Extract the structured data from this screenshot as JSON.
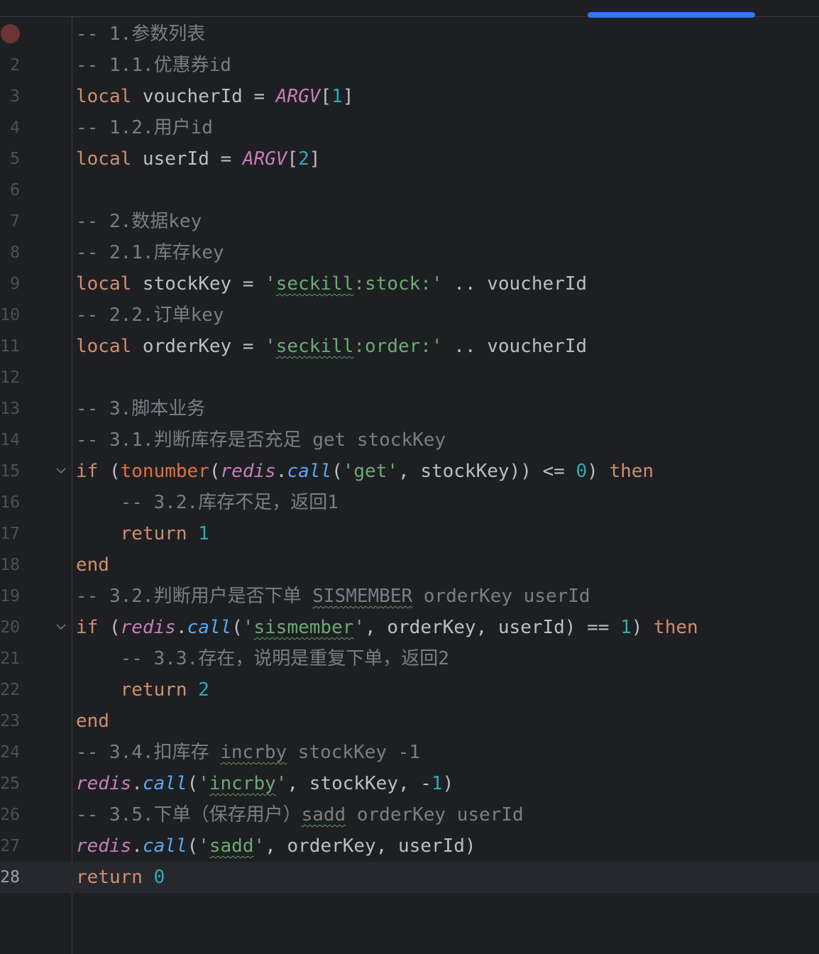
{
  "editor": {
    "current_line": 28,
    "breakpoint_line": 1,
    "fold_lines": [
      15,
      20
    ],
    "colors": {
      "background": "#1e1f22",
      "keyword": "#cf8e6d",
      "string": "#6aab73",
      "number": "#2aacb8",
      "comment": "#7a7e85",
      "global": "#c77dbb",
      "method": "#56a8f5",
      "scrollbar": "#3574f0"
    },
    "lines": [
      {
        "num": "1",
        "tokens": [
          [
            "c",
            "-- 1.参数列表"
          ]
        ]
      },
      {
        "num": "2",
        "tokens": [
          [
            "c",
            "-- 1.1.优惠券id"
          ]
        ]
      },
      {
        "num": "3",
        "tokens": [
          [
            "k",
            "local"
          ],
          [
            "t",
            " voucherId = "
          ],
          [
            "g",
            "ARGV"
          ],
          [
            "t",
            "["
          ],
          [
            "n",
            "1"
          ],
          [
            "t",
            "]"
          ]
        ]
      },
      {
        "num": "4",
        "tokens": [
          [
            "c",
            "-- 1.2.用户id"
          ]
        ]
      },
      {
        "num": "5",
        "tokens": [
          [
            "k",
            "local"
          ],
          [
            "t",
            " userId = "
          ],
          [
            "g",
            "ARGV"
          ],
          [
            "t",
            "["
          ],
          [
            "n",
            "2"
          ],
          [
            "t",
            "]"
          ]
        ]
      },
      {
        "num": "6",
        "tokens": []
      },
      {
        "num": "7",
        "tokens": [
          [
            "c",
            "-- 2.数据key"
          ]
        ]
      },
      {
        "num": "8",
        "tokens": [
          [
            "c",
            "-- 2.1.库存key"
          ]
        ]
      },
      {
        "num": "9",
        "tokens": [
          [
            "k",
            "local"
          ],
          [
            "t",
            " stockKey = "
          ],
          [
            "s",
            "'"
          ],
          [
            "s typo",
            "seckill"
          ],
          [
            "s",
            ":stock:'"
          ],
          [
            "t",
            " .. voucherId"
          ]
        ]
      },
      {
        "num": "10",
        "tokens": [
          [
            "c",
            "-- 2.2.订单key"
          ]
        ]
      },
      {
        "num": "11",
        "tokens": [
          [
            "k",
            "local"
          ],
          [
            "t",
            " orderKey = "
          ],
          [
            "s",
            "'"
          ],
          [
            "s typo",
            "seckill"
          ],
          [
            "s",
            ":order:'"
          ],
          [
            "t",
            " .. voucherId"
          ]
        ]
      },
      {
        "num": "12",
        "tokens": []
      },
      {
        "num": "13",
        "tokens": [
          [
            "c",
            "-- 3.脚本业务"
          ]
        ]
      },
      {
        "num": "14",
        "tokens": [
          [
            "c",
            "-- 3.1.判断库存是否充足 get stockKey"
          ]
        ]
      },
      {
        "num": "15",
        "tokens": [
          [
            "k",
            "if"
          ],
          [
            "t",
            " ("
          ],
          [
            "f",
            "tonumber"
          ],
          [
            "t",
            "("
          ],
          [
            "g",
            "redis"
          ],
          [
            "t",
            "."
          ],
          [
            "m",
            "call"
          ],
          [
            "t",
            "("
          ],
          [
            "s",
            "'get'"
          ],
          [
            "t",
            ", stockKey)) <= "
          ],
          [
            "n",
            "0"
          ],
          [
            "t",
            ") "
          ],
          [
            "k",
            "then"
          ]
        ]
      },
      {
        "num": "16",
        "tokens": [
          [
            "t",
            "    "
          ],
          [
            "c",
            "-- 3.2.库存不足，返回1"
          ]
        ]
      },
      {
        "num": "17",
        "tokens": [
          [
            "t",
            "    "
          ],
          [
            "k",
            "return"
          ],
          [
            "t",
            " "
          ],
          [
            "n",
            "1"
          ]
        ]
      },
      {
        "num": "18",
        "tokens": [
          [
            "k",
            "end"
          ]
        ]
      },
      {
        "num": "19",
        "tokens": [
          [
            "c",
            "-- 3.2.判断用户是否下单 "
          ],
          [
            "c typo",
            "SISMEMBER"
          ],
          [
            "c",
            " orderKey userId"
          ]
        ]
      },
      {
        "num": "20",
        "tokens": [
          [
            "k",
            "if"
          ],
          [
            "t",
            " ("
          ],
          [
            "g",
            "redis"
          ],
          [
            "t",
            "."
          ],
          [
            "m",
            "call"
          ],
          [
            "t",
            "("
          ],
          [
            "s",
            "'"
          ],
          [
            "s typo",
            "sismember"
          ],
          [
            "s",
            "'"
          ],
          [
            "t",
            ", orderKey, userId) == "
          ],
          [
            "n",
            "1"
          ],
          [
            "t",
            ") "
          ],
          [
            "k",
            "then"
          ]
        ]
      },
      {
        "num": "21",
        "tokens": [
          [
            "t",
            "    "
          ],
          [
            "c",
            "-- 3.3.存在，说明是重复下单，返回2"
          ]
        ]
      },
      {
        "num": "22",
        "tokens": [
          [
            "t",
            "    "
          ],
          [
            "k",
            "return"
          ],
          [
            "t",
            " "
          ],
          [
            "n",
            "2"
          ]
        ]
      },
      {
        "num": "23",
        "tokens": [
          [
            "k",
            "end"
          ]
        ]
      },
      {
        "num": "24",
        "tokens": [
          [
            "c",
            "-- 3.4.扣库存 "
          ],
          [
            "c typo",
            "incrby"
          ],
          [
            "c",
            " stockKey -1"
          ]
        ]
      },
      {
        "num": "25",
        "tokens": [
          [
            "g",
            "redis"
          ],
          [
            "t",
            "."
          ],
          [
            "m",
            "call"
          ],
          [
            "t",
            "("
          ],
          [
            "s",
            "'"
          ],
          [
            "s typo",
            "incrby"
          ],
          [
            "s",
            "'"
          ],
          [
            "t",
            ", stockKey, -"
          ],
          [
            "n",
            "1"
          ],
          [
            "t",
            ")"
          ]
        ]
      },
      {
        "num": "26",
        "tokens": [
          [
            "c",
            "-- 3.5.下单（保存用户）"
          ],
          [
            "c typo",
            "sadd"
          ],
          [
            "c",
            " orderKey userId"
          ]
        ]
      },
      {
        "num": "27",
        "tokens": [
          [
            "g",
            "redis"
          ],
          [
            "t",
            "."
          ],
          [
            "m",
            "call"
          ],
          [
            "t",
            "("
          ],
          [
            "s",
            "'"
          ],
          [
            "s typo",
            "sadd"
          ],
          [
            "s",
            "'"
          ],
          [
            "t",
            ", orderKey, userId)"
          ]
        ]
      },
      {
        "num": "28",
        "tokens": [
          [
            "k",
            "return"
          ],
          [
            "t",
            " "
          ],
          [
            "n",
            "0"
          ]
        ]
      }
    ]
  }
}
